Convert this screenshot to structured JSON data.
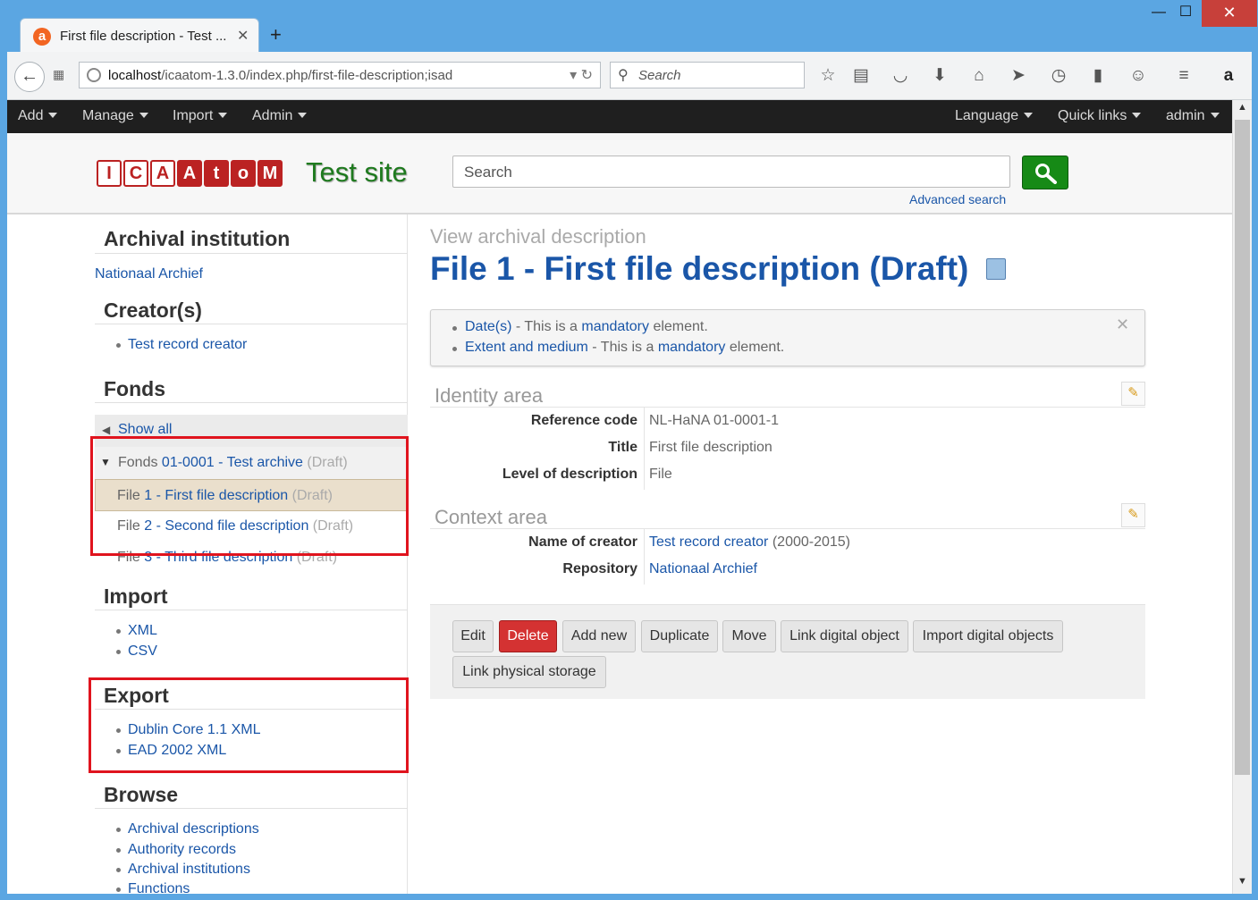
{
  "browser": {
    "tab_title": "First file description - Test ...",
    "tab_favicon": "a",
    "url_host": "localhost",
    "url_path": "/icaatom-1.3.0/index.php/first-file-description;isad",
    "search_placeholder": "Search",
    "amazon_label": "a"
  },
  "topnav": {
    "left": [
      "Add",
      "Manage",
      "Import",
      "Admin"
    ],
    "right": [
      "Language",
      "Quick links",
      "admin"
    ]
  },
  "header": {
    "logo_letters": [
      "I",
      "C",
      "A",
      "A",
      "t",
      "o",
      "M"
    ],
    "site_name": "Test site",
    "search_placeholder": "Search",
    "advanced_search": "Advanced search"
  },
  "sidebar": {
    "institution_heading": "Archival institution",
    "institution_link": "Nationaal Archief",
    "creators_heading": "Creator(s)",
    "creator_link": "Test record creator",
    "fonds_heading": "Fonds",
    "show_all": "Show all",
    "tree": [
      {
        "prefix": "Fonds",
        "code": "01-0001",
        "title": "Test archive",
        "status": "(Draft)"
      },
      {
        "prefix": "File",
        "code": "1",
        "title": "First file description",
        "status": "(Draft)"
      },
      {
        "prefix": "File",
        "code": "2",
        "title": "Second file description",
        "status": "(Draft)"
      },
      {
        "prefix": "File",
        "code": "3",
        "title": "Third file description",
        "status": "(Draft)"
      }
    ],
    "import_heading": "Import",
    "import_links": [
      "XML",
      "CSV"
    ],
    "export_heading": "Export",
    "export_links": [
      "Dublin Core 1.1 XML",
      "EAD 2002 XML"
    ],
    "browse_heading": "Browse",
    "browse_links": [
      "Archival descriptions",
      "Authority records",
      "Archival institutions",
      "Functions"
    ]
  },
  "main": {
    "view_label": "View archival description",
    "title": "File 1 - First file description (Draft)",
    "alerts": [
      {
        "field": "Date(s)",
        "text1": " - This is a ",
        "keyword": "mandatory",
        "text2": " element."
      },
      {
        "field": "Extent and medium",
        "text1": " - This is a ",
        "keyword": "mandatory",
        "text2": " element."
      }
    ],
    "identity_area": {
      "heading": "Identity area",
      "fields": [
        {
          "label": "Reference code",
          "value": "NL-HaNA 01-0001-1"
        },
        {
          "label": "Title",
          "value": "First file description"
        },
        {
          "label": "Level of description",
          "value": "File"
        }
      ]
    },
    "context_area": {
      "heading": "Context area",
      "creator_label": "Name of creator",
      "creator_value": "Test record creator",
      "creator_dates": " (2000-2015)",
      "repository_label": "Repository",
      "repository_value": "Nationaal Archief"
    },
    "buttons": [
      "Edit",
      "Delete",
      "Add new",
      "Duplicate",
      "Move",
      "Link digital object",
      "Import digital objects",
      "Link physical storage"
    ]
  },
  "colors": {
    "link": "#1a56a8",
    "site_name": "#1e7a1e",
    "delete_button": "#d43232",
    "highlight_box": "#e0141e"
  }
}
